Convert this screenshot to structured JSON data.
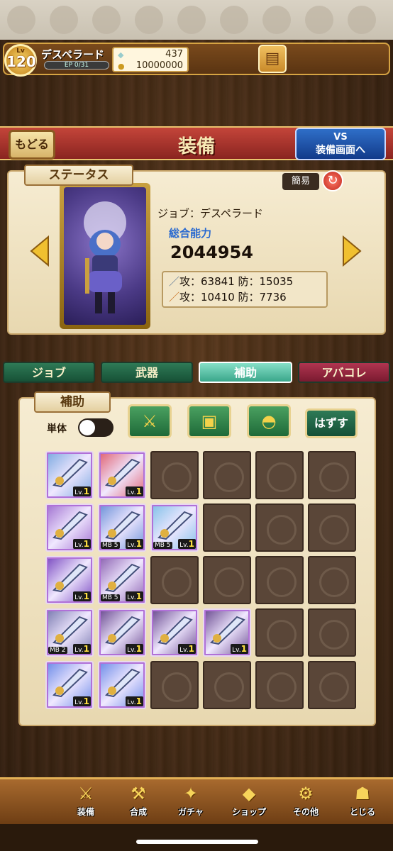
{
  "player": {
    "level_tag": "Lv",
    "level": "120",
    "name": "デスペラード",
    "ep": "EP 0/31",
    "gems": "437",
    "coins": "10000000"
  },
  "header": {
    "title": "装備",
    "back_label": "もどる",
    "vs_line1": "VS",
    "vs_line2": "装備画面へ"
  },
  "status": {
    "tag": "ステータス",
    "simple_label": "簡易",
    "job": "ジョブ：デスペラード",
    "power_label": "総合能力",
    "power": "2044954",
    "stat_row1": "攻：63841 防：15035",
    "stat_row2": "攻：10410 防：7736"
  },
  "tabs": [
    "ジョブ",
    "武器",
    "補助",
    "アバコレ"
  ],
  "inventory": {
    "tag": "補助",
    "single_label": "単体",
    "remove_label": "はずす",
    "lv_prefix": "Lv.",
    "items": [
      {
        "lv": "1",
        "mb": "",
        "color": "#7aa8e0"
      },
      {
        "lv": "1",
        "mb": "",
        "color": "#e06070"
      },
      {
        "lv": "1",
        "mb": "",
        "color": "#a070d0"
      },
      {
        "lv": "1",
        "mb": "MB 5",
        "color": "#6a90d8"
      },
      {
        "lv": "1",
        "mb": "MB 5",
        "color": "#80c0e8"
      },
      {
        "lv": "1",
        "mb": "",
        "color": "#7a4ac0"
      },
      {
        "lv": "1",
        "mb": "MB 5",
        "color": "#8a60b0"
      },
      {
        "lv": "1",
        "mb": "MB 2",
        "color": "#7a7ab0"
      },
      {
        "lv": "1",
        "mb": "",
        "color": "#6a4a90"
      },
      {
        "lv": "1",
        "mb": "",
        "color": "#6a4a90"
      },
      {
        "lv": "1",
        "mb": "",
        "color": "#6a4a90"
      },
      {
        "lv": "1",
        "mb": "",
        "color": "#6a8ae8"
      },
      {
        "lv": "1",
        "mb": "",
        "color": "#6a8ae8"
      }
    ]
  },
  "nav": [
    "装備",
    "合成",
    "ガチャ",
    "ショップ",
    "その他",
    "とじる"
  ]
}
